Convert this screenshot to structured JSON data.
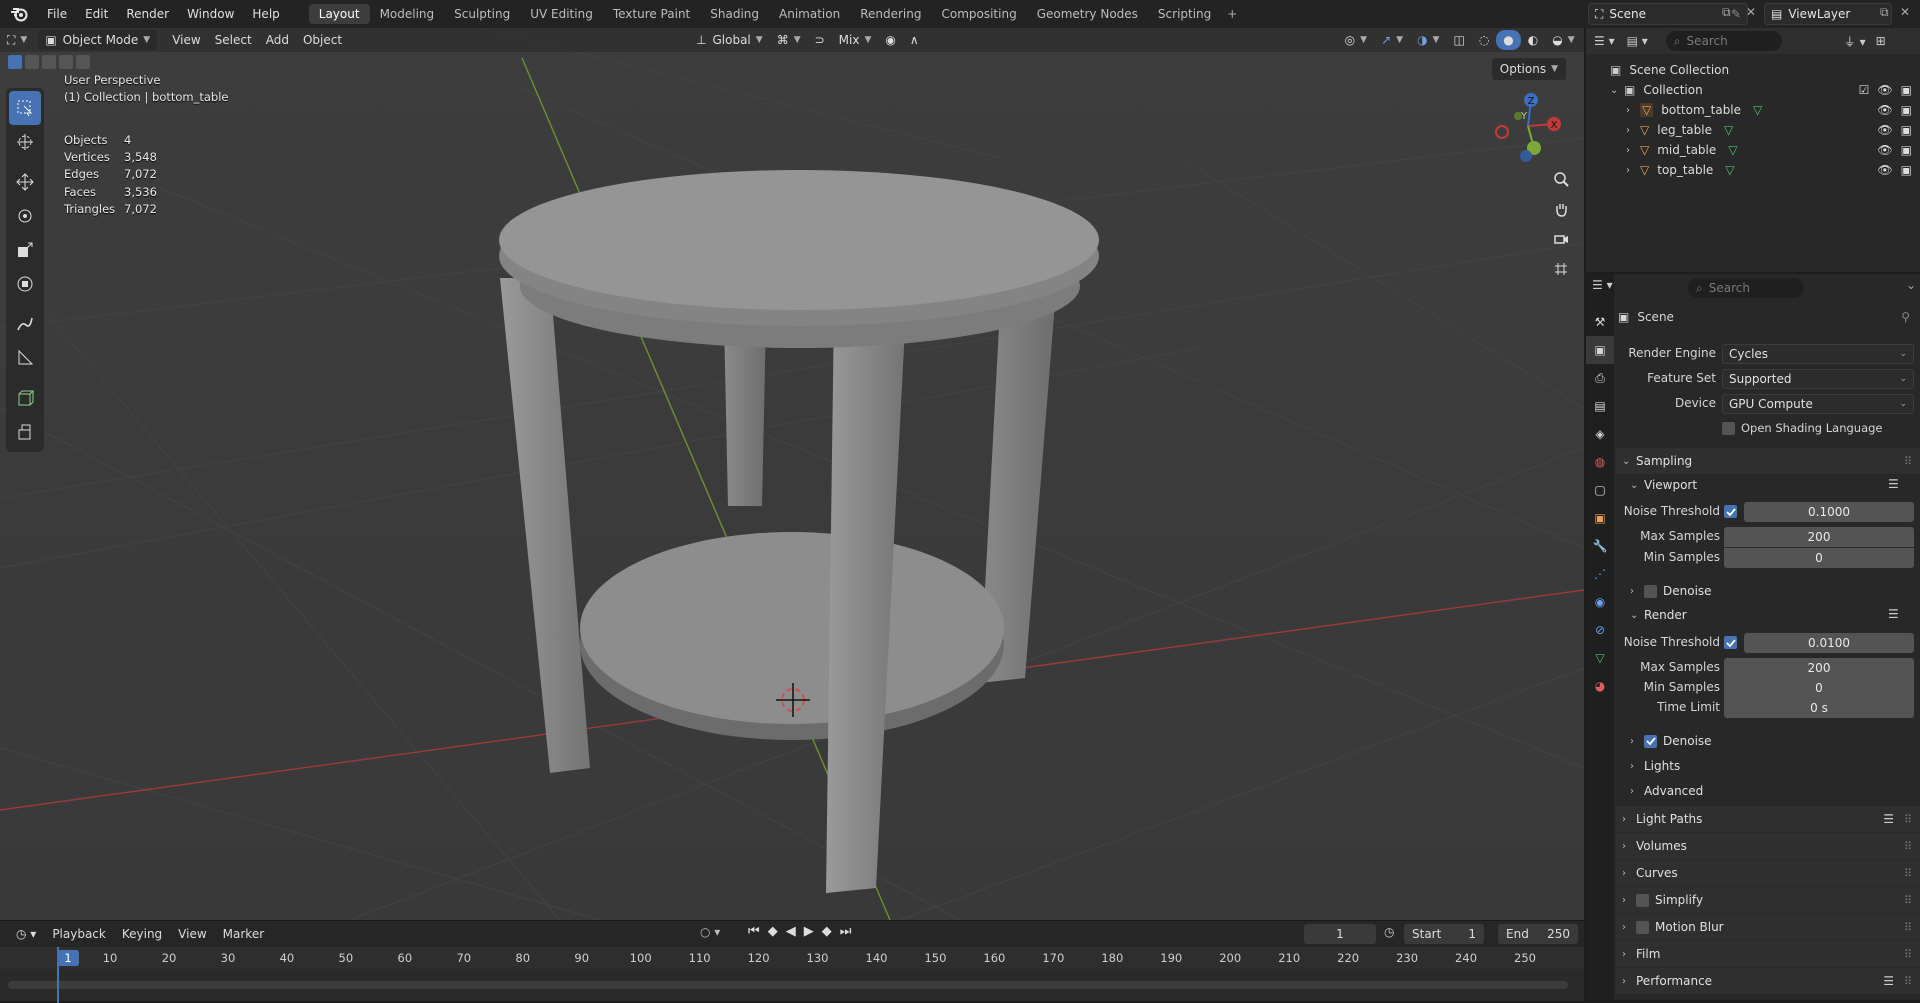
{
  "topbar": {
    "menu": [
      "File",
      "Edit",
      "Render",
      "Window",
      "Help"
    ],
    "workspaces": [
      "Layout",
      "Modeling",
      "Sculpting",
      "UV Editing",
      "Texture Paint",
      "Shading",
      "Animation",
      "Rendering",
      "Compositing",
      "Geometry Nodes",
      "Scripting"
    ],
    "active_workspace": "Layout",
    "scene": "Scene",
    "view_layer": "ViewLayer"
  },
  "viewport_header": {
    "mode": "Object Mode",
    "menus": [
      "View",
      "Select",
      "Add",
      "Object"
    ],
    "transform_orientation": "Global",
    "snap_mode": "Mix",
    "options": "Options"
  },
  "viewport_overlay": {
    "perspective": "User Perspective",
    "collection": "(1) Collection | bottom_table",
    "stats": [
      {
        "label": "Objects",
        "value": "4"
      },
      {
        "label": "Vertices",
        "value": "3,548"
      },
      {
        "label": "Edges",
        "value": "7,072"
      },
      {
        "label": "Faces",
        "value": "3,536"
      },
      {
        "label": "Triangles",
        "value": "7,072"
      }
    ],
    "gizmo": {
      "x": "X",
      "y": "Y",
      "z": "Z"
    }
  },
  "timeline": {
    "menus": [
      "Playback",
      "Keying",
      "View",
      "Marker"
    ],
    "current_frame": "1",
    "start_label": "Start",
    "start": "1",
    "end_label": "End",
    "end": "250",
    "ruler": [
      "1",
      "10",
      "20",
      "30",
      "40",
      "50",
      "60",
      "70",
      "80",
      "90",
      "100",
      "110",
      "120",
      "130",
      "140",
      "150",
      "160",
      "170",
      "180",
      "190",
      "200",
      "210",
      "220",
      "230",
      "240",
      "250"
    ]
  },
  "outliner": {
    "search_placeholder": "Search",
    "scene_collection": "Scene Collection",
    "collection": "Collection",
    "objects": [
      "bottom_table",
      "leg_table",
      "mid_table",
      "top_table"
    ]
  },
  "properties": {
    "search_placeholder": "Search",
    "context": "Scene",
    "render_engine_label": "Render Engine",
    "render_engine": "Cycles",
    "feature_set_label": "Feature Set",
    "feature_set": "Supported",
    "device_label": "Device",
    "device": "GPU Compute",
    "osl_label": "Open Shading Language",
    "sampling": {
      "title": "Sampling",
      "viewport": {
        "title": "Viewport",
        "noise_threshold_label": "Noise Threshold",
        "noise_threshold": "0.1000",
        "max_samples_label": "Max Samples",
        "max_samples": "200",
        "min_samples_label": "Min Samples",
        "min_samples": "0",
        "denoise_label": "Denoise"
      },
      "render": {
        "title": "Render",
        "noise_threshold_label": "Noise Threshold",
        "noise_threshold": "0.0100",
        "max_samples_label": "Max Samples",
        "max_samples": "200",
        "min_samples_label": "Min Samples",
        "min_samples": "0",
        "time_limit_label": "Time Limit",
        "time_limit": "0 s",
        "denoise_label": "Denoise"
      },
      "lights": "Lights",
      "advanced": "Advanced"
    },
    "panels": [
      "Light Paths",
      "Volumes",
      "Curves",
      "Simplify",
      "Motion Blur",
      "Film",
      "Performance"
    ]
  },
  "colors": {
    "accent": "#4772b3",
    "x_axis": "#c23a3a",
    "y_axis": "#7fa83a",
    "z_axis": "#3b6fc2",
    "object_icon": "#e8a25a",
    "mesh_icon": "#4fc07a"
  }
}
